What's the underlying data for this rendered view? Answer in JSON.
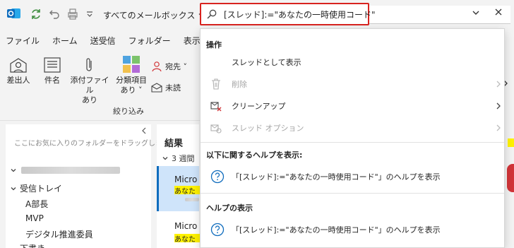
{
  "titlebar": {
    "mailbox_selector": "すべてのメールボックス",
    "search_query": "[スレッド]:=\"あなたの一時使用コード\""
  },
  "menubar": {
    "items": [
      "ファイル",
      "ホーム",
      "送受信",
      "フォルダー",
      "表示",
      "開"
    ]
  },
  "ribbon": {
    "buttons": {
      "sender": "差出人",
      "subject": "件名",
      "attachment_line1": "添付ファイル",
      "attachment_line2": "あり",
      "category_line1": "分類項目",
      "category_line2": "あり ˅",
      "to": "宛先 ˅",
      "unread": "未読"
    },
    "group_label": "絞り込み"
  },
  "nav": {
    "favorites_hint": "ここにお気に入りのフォルダーをドラッグします",
    "folders": [
      "受信トレイ",
      "A部長",
      "MVP",
      "デジタル推進委員",
      "下書き"
    ]
  },
  "message_list": {
    "title": "結果",
    "group": "3 週間",
    "items": [
      {
        "sender": "Micro",
        "preview": "あなた"
      },
      {
        "sender": "Micro",
        "preview": "あなた"
      }
    ]
  },
  "dropdown": {
    "section_actions": "操作",
    "actions": [
      {
        "label": "スレッドとして表示",
        "icon": "none",
        "disabled": false,
        "submenu": false
      },
      {
        "label": "削除",
        "icon": "trash-icon",
        "disabled": true,
        "submenu": true
      },
      {
        "label": "クリーンアップ",
        "icon": "cleanup-icon",
        "disabled": false,
        "submenu": true
      },
      {
        "label": "スレッド オプション",
        "icon": "thread-options-icon",
        "disabled": true,
        "submenu": true
      }
    ],
    "section_help_about": "以下に関するヘルプを表示:",
    "help_about_item": "「[スレッド]:=\"あなたの一時使用コード\"」のヘルプを表示",
    "section_help_view": "ヘルプの表示",
    "help_view_item": "「[スレッド]:=\"あなたの一時使用コード\"」のヘルプを表示"
  },
  "colors": {
    "accent": "#0f6cbd",
    "search_highlight_border": "#d8231f",
    "selected_message_bg": "#cfe4fa",
    "text_highlight": "#fff200"
  }
}
